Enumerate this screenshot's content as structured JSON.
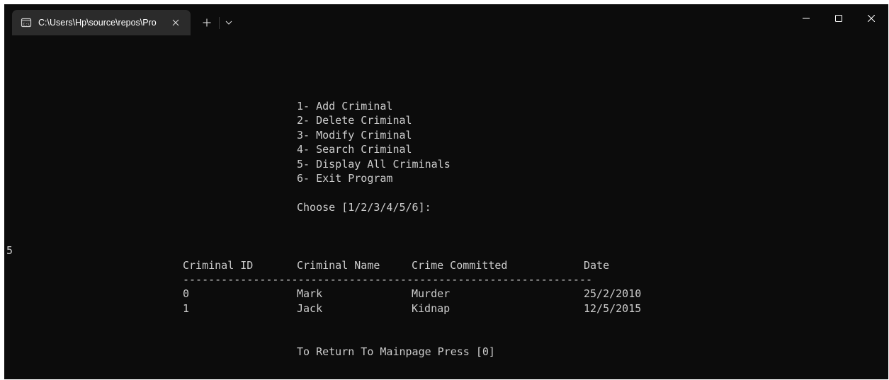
{
  "window": {
    "tab_title": "C:\\Users\\Hp\\source\\repos\\Pro",
    "tab_icon": "console-icon",
    "controls": [
      "minimize-icon",
      "maximize-icon",
      "close-icon"
    ]
  },
  "menu": {
    "items": [
      "1- Add Criminal",
      "2- Delete Criminal",
      "3- Modify Criminal",
      "4- Search Criminal",
      "5- Display All Criminals",
      "6- Exit Program"
    ],
    "prompt": "Choose [1/2/3/4/5/6]:"
  },
  "input_echo": "5",
  "table": {
    "headers": [
      "Criminal ID",
      "Criminal Name",
      "Crime Committed",
      "Date"
    ],
    "separator": "----------------------------------------------------------------",
    "rows": [
      [
        "0",
        "Mark",
        "Murder",
        "25/2/2010"
      ],
      [
        "1",
        "Jack",
        "Kidnap",
        "12/5/2015"
      ]
    ]
  },
  "footer": "To Return To Mainpage Press [0]",
  "colors": {
    "background": "#0c0c0c",
    "text": "#cccccc",
    "tab": "#2b2b2b"
  }
}
